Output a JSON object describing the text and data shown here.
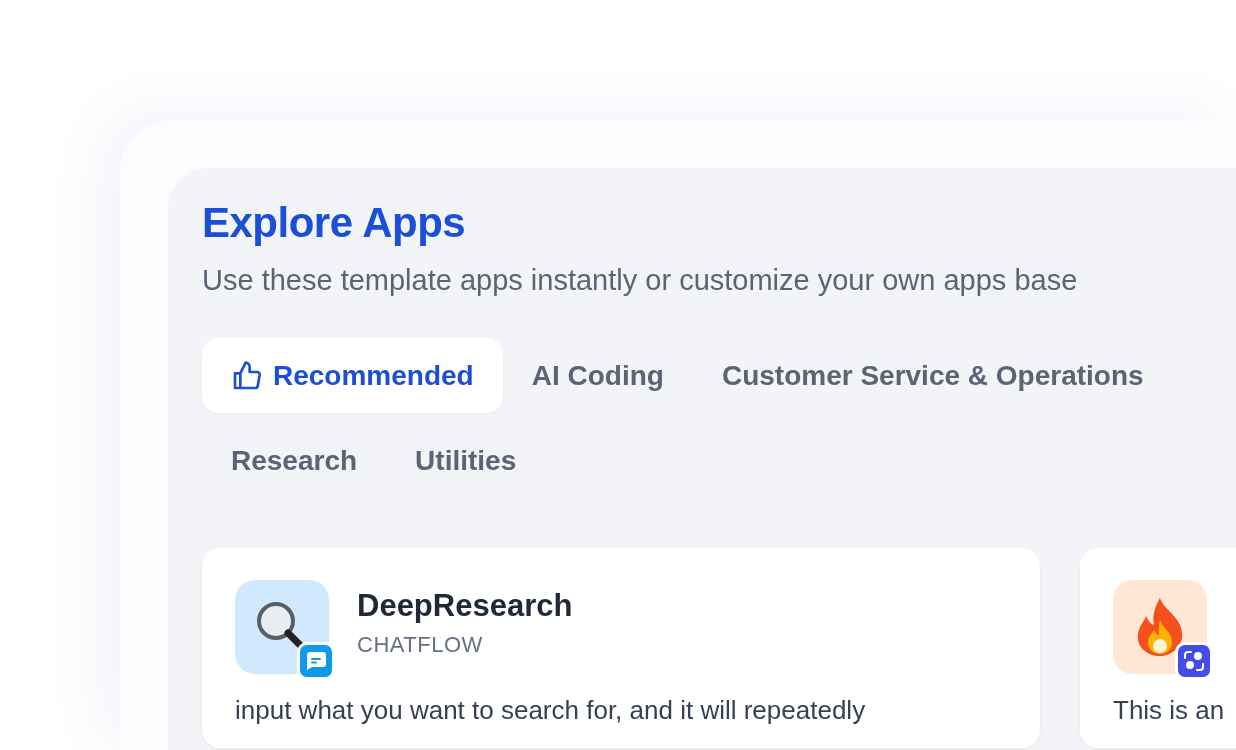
{
  "header": {
    "title": "Explore Apps",
    "subtitle": "Use these template apps instantly or customize your own apps base"
  },
  "tabs": [
    {
      "label": "Recommended",
      "selected": true,
      "kind": "recommended"
    },
    {
      "label": "AI Coding",
      "selected": false,
      "kind": "plain"
    },
    {
      "label": "Customer Service & Operations",
      "selected": false,
      "kind": "plain"
    },
    {
      "label": "Research",
      "selected": false,
      "kind": "plain"
    },
    {
      "label": "Utilities",
      "selected": false,
      "kind": "plain"
    }
  ],
  "apps": [
    {
      "name": "DeepResearch",
      "type": "CHATFLOW",
      "description": "input what you want to search for, and it will repeatedly",
      "kind": "chatflow"
    },
    {
      "description": "This is an",
      "kind": "agent"
    }
  ]
}
